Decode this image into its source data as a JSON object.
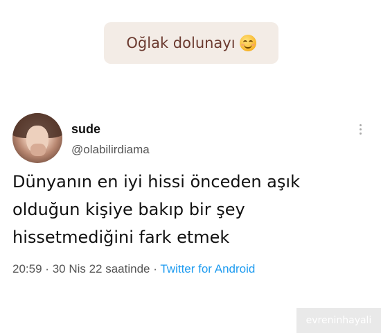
{
  "caption": {
    "text": "Oğlak dolunayı",
    "emoji": "smiling-face-emoji"
  },
  "tweet": {
    "name": "sude",
    "handle": "@olabilirdiama",
    "lines": [
      "Dünyanın en iyi hissi önceden aşık",
      "olduğun kişiye bakıp bir şey",
      "hissetmediğini fark etmek"
    ],
    "time": "20:59",
    "separator": "·",
    "date": "30 Nis 22 saatinde",
    "source": "Twitter for Android"
  },
  "watermark": "evreninhayali",
  "colors": {
    "caption_bg": "#f3ece6",
    "caption_text": "#6b3a2f",
    "link": "#1d9bf0"
  }
}
